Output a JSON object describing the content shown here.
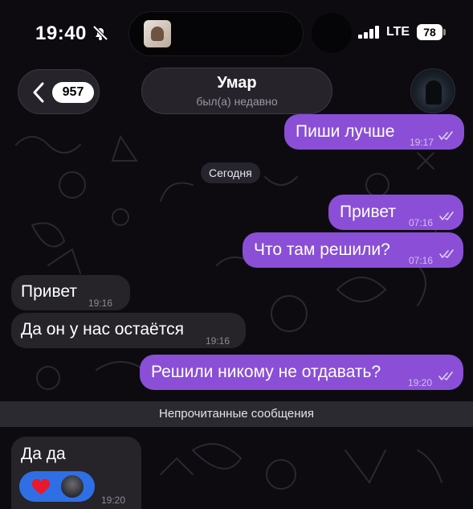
{
  "status_bar": {
    "time": "19:40",
    "network": "LTE",
    "battery": "78"
  },
  "header": {
    "back_badge": "957",
    "contact_name": "Умар",
    "contact_status": "был(а) недавно"
  },
  "date_separator": "Сегодня",
  "messages": [
    {
      "text": "Пиши лучше",
      "time": "19:17",
      "direction": "outgoing",
      "read": true
    },
    {
      "text": "Привет",
      "time": "07:16",
      "direction": "outgoing",
      "read": true
    },
    {
      "text": "Что там решили?",
      "time": "07:16",
      "direction": "outgoing",
      "read": true
    },
    {
      "text": "Привет",
      "time": "19:16",
      "direction": "incoming"
    },
    {
      "text": "Да он у нас остаётся",
      "time": "19:16",
      "direction": "incoming"
    },
    {
      "text": "Решили никому не отдавать?",
      "time": "19:20",
      "direction": "outgoing",
      "read": true
    }
  ],
  "unread_divider": "Непрочитанные сообщения",
  "last_message": {
    "text": "Да да",
    "time": "19:20",
    "direction": "incoming",
    "reaction": "heart-icon"
  },
  "colors": {
    "outgoing_bubble": "#8a4fd6",
    "incoming_bubble": "#262429",
    "reaction_pill": "#2f6fe6",
    "background": "#0d0b10"
  }
}
